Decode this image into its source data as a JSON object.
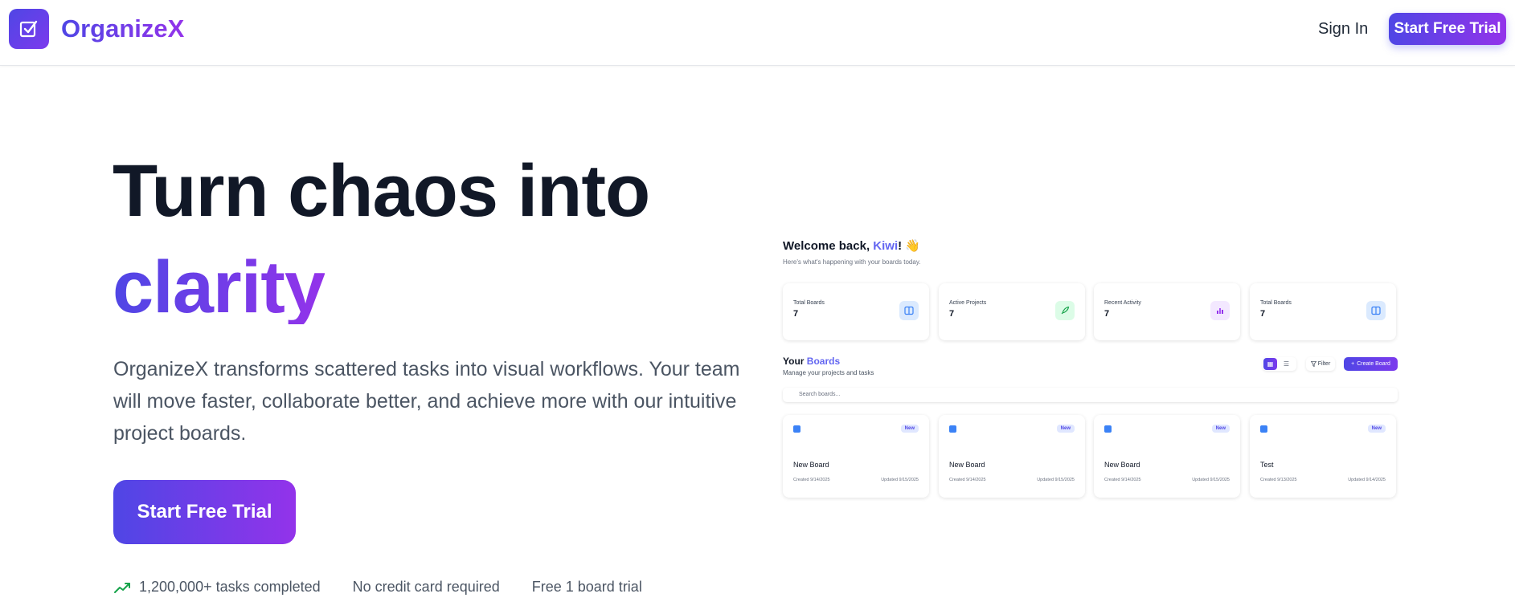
{
  "header": {
    "brand": "OrganizeX",
    "sign_in": "Sign In",
    "trial": "Start Free Trial"
  },
  "hero": {
    "headline_line1": "Turn chaos into",
    "headline_line2": "clarity",
    "lead": "OrganizeX transforms scattered tasks into visual workflows. Your team will move faster, collaborate better, and achieve more with our intuitive project boards.",
    "cta": "Start Free Trial",
    "stats": [
      "1,200,000+ tasks completed",
      "No credit card required",
      "Free 1 board trial"
    ]
  },
  "mockup": {
    "welcome_prefix": "Welcome back, ",
    "welcome_name": "Kiwi",
    "welcome_suffix": "! 👋",
    "welcome_sub": "Here's what's happening with your boards today.",
    "stat_cards": [
      {
        "label": "Total Boards",
        "value": "7",
        "icon": "columns-icon"
      },
      {
        "label": "Active Projects",
        "value": "7",
        "icon": "rocket-icon"
      },
      {
        "label": "Recent Activity",
        "value": "7",
        "icon": "bar-chart-icon"
      },
      {
        "label": "Total Boards",
        "value": "7",
        "icon": "columns-icon"
      }
    ],
    "boards_title_prefix": "Your ",
    "boards_title_accent": "Boards",
    "boards_sub": "Manage your projects and tasks",
    "filter": "Filter",
    "create": "Create Board",
    "search_placeholder": "Search boards...",
    "boards": [
      {
        "badge": "New",
        "name": "New Board",
        "created": "Created 9/14/2025",
        "updated": "Updated 9/15/2025"
      },
      {
        "badge": "New",
        "name": "New Board",
        "created": "Created 9/14/2025",
        "updated": "Updated 9/15/2025"
      },
      {
        "badge": "New",
        "name": "New Board",
        "created": "Created 9/14/2025",
        "updated": "Updated 9/15/2025"
      },
      {
        "badge": "New",
        "name": "Test",
        "created": "Created 9/13/2025",
        "updated": "Updated 9/14/2025"
      }
    ]
  },
  "colors": {
    "brand_start": "#4f46e5",
    "brand_end": "#9333ea",
    "trend_green": "#16a34a"
  }
}
